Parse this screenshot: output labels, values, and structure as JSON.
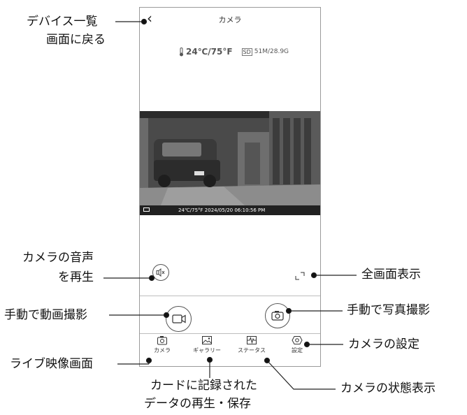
{
  "header": {
    "back_icon": "chevron-left-icon",
    "title": "カメラ"
  },
  "status": {
    "temperature": "24℃/75°F",
    "sd_icon": "sd-card-icon",
    "storage": "51M/28.9G"
  },
  "video": {
    "osd_text": "24℃/75°F  2024/05/20  06:10:56  PM"
  },
  "tabs": [
    {
      "label": "カメラ",
      "icon": "camera-icon"
    },
    {
      "label": "ギャラリー",
      "icon": "gallery-icon"
    },
    {
      "label": "ステータス",
      "icon": "status-waveform-icon"
    },
    {
      "label": "設定",
      "icon": "gear-icon"
    }
  ],
  "callouts": {
    "device_list_line1": "デバイス一覧",
    "device_list_line2": "画面に戻る",
    "audio_line1": "カメラの音声",
    "audio_line2": "を再生",
    "fullscreen": "全画面表示",
    "manual_video": "手動で動画撮影",
    "manual_photo": "手動で写真撮影",
    "settings": "カメラの設定",
    "live_view": "ライブ映像画面",
    "gallery_line1": "カードに記録された",
    "gallery_line2": "データの再生・保存",
    "status": "カメラの状態表示"
  }
}
